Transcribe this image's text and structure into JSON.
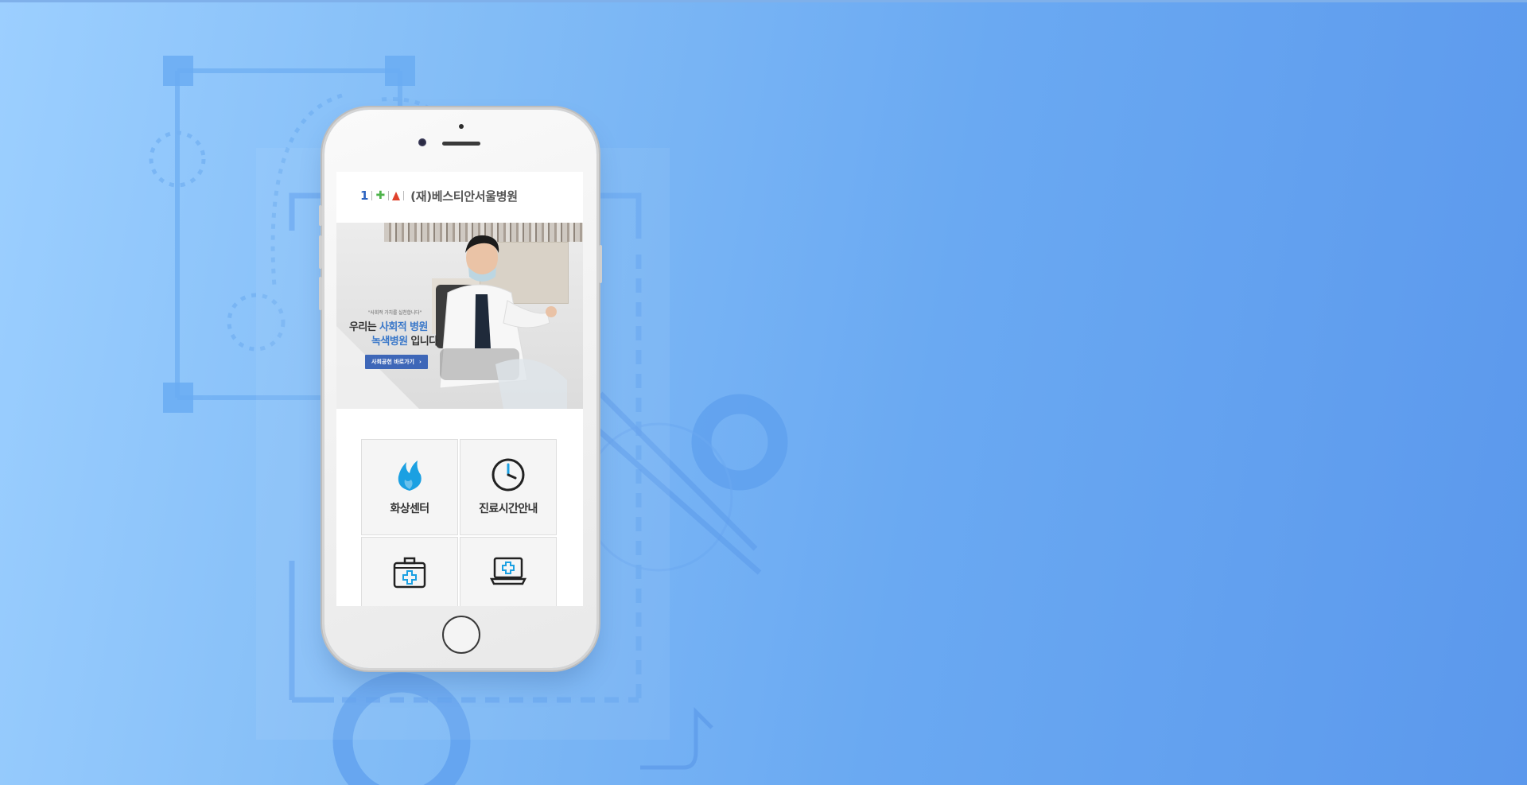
{
  "colors": {
    "background_light": "#9ccfff",
    "background_dark": "#5b98ec",
    "accent_blue": "#3a78c9",
    "button_blue": "#3e67b8",
    "logo_green": "#4eb34a",
    "logo_red": "#e0422c",
    "icon_cyan": "#1ba0e2"
  },
  "site": {
    "logo_number": "1",
    "logo_icons": [
      "cross-icon",
      "flame-icon"
    ],
    "name": "(재)베스티안서울병원"
  },
  "hero": {
    "quote": "\"사회적 가치를 실천합니다\"",
    "line1_prefix": "우리는 ",
    "line1_highlight": "사회적 병원",
    "line2_highlight": "녹색병원",
    "line2_suffix": " 입니다",
    "button_label": "사회공헌 바로가기",
    "button_icon": "chevron-right-icon"
  },
  "menu": [
    {
      "label": "화상센터",
      "icon": "flame-icon"
    },
    {
      "label": "진료시간안내",
      "icon": "clock-icon"
    },
    {
      "label": "",
      "icon": "first-aid-kit-icon"
    },
    {
      "label": "",
      "icon": "medical-laptop-icon"
    }
  ]
}
